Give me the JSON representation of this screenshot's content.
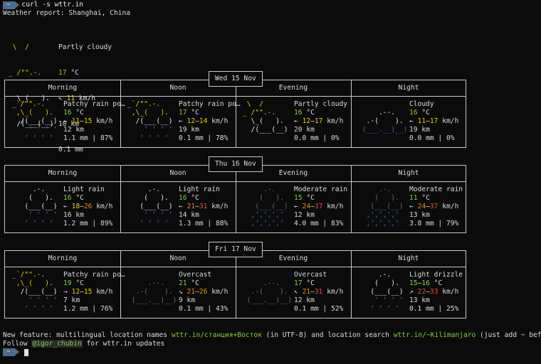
{
  "prompt": {
    "tilde": "~",
    "command": "curl -s wttr.in"
  },
  "report_title": "Weather report: Shanghai, China",
  "current": {
    "art": [
      " \\  /      ",
      "_ /\"\".-.   ",
      "  \\_(   ).  ",
      "  /(___(__) "
    ],
    "condition": "Partly cloudy",
    "temp": "17",
    "temp_unit": " °C",
    "wind_arrow": "↖ ",
    "wind": "11",
    "wind_unit": " km/h",
    "visibility": "10 km",
    "precip": "0.1 mm"
  },
  "periods": [
    "Morning",
    "Noon",
    "Evening",
    "Night"
  ],
  "days": [
    {
      "label": "Wed 15 Nov",
      "slots": [
        {
          "art": [
            "_`/\"\".-.   ",
            " ,\\_(   ).  ",
            "  /(___(__) ",
            "    ‘ ‘ ‘ ‘ ",
            "   ‘ ‘ ‘ ‘  "
          ],
          "condition": "Patchy rain po…",
          "temp": "16",
          "wind_arrow": "← ",
          "wind_a": "11",
          "wind_b": "15",
          "wind_color_a": "y",
          "wind_color_b": "y",
          "vis": "12 km",
          "precip": "1.1 mm | 87%",
          "artcolor": "mix"
        },
        {
          "art": [
            "_`/\"\".-.   ",
            " ,\\_(   ).  ",
            "  /(___(__) ",
            "    ‘ ‘ ‘ ‘ ",
            "   ‘ ‘ ‘ ‘  "
          ],
          "condition": "Patchy rain po…",
          "temp": "17",
          "wind_arrow": "← ",
          "wind_a": "12",
          "wind_b": "14",
          "wind_color_a": "y",
          "wind_color_b": "y",
          "vis": "19 km",
          "precip": "0.1 mm | 78%",
          "artcolor": "mix"
        },
        {
          "art": [
            " \\  /      ",
            "_ /\"\".-.   ",
            "  \\_(   ).  ",
            "  /(___(__) ",
            "            "
          ],
          "condition": "Partly cloudy",
          "temp": "16",
          "wind_arrow": "← ",
          "wind_a": "12",
          "wind_b": "17",
          "wind_color_a": "y",
          "wind_color_b": "y",
          "vis": "20 km",
          "precip": "0.0 mm | 0%",
          "artcolor": "sun"
        },
        {
          "art": [
            "            ",
            "     .--.   ",
            "  .-(    ).  ",
            " (___.__)__) ",
            "            "
          ],
          "condition": "Cloudy",
          "temp": "16",
          "wind_arrow": "← ",
          "wind_a": "11",
          "wind_b": "17",
          "wind_color_a": "y",
          "wind_color_b": "y",
          "vis": "19 km",
          "precip": "0.0 mm | 0%",
          "artcolor": "white"
        }
      ]
    },
    {
      "label": "Thu 16 Nov",
      "slots": [
        {
          "art": [
            "     .-.    ",
            "    (   ).  ",
            "   (___(__) ",
            "    ‘ ‘ ‘ ‘ ",
            "   ‘ ‘ ‘ ‘  "
          ],
          "condition": "Light rain",
          "temp": "16",
          "wind_arrow": "← ",
          "wind_a": "18",
          "wind_b": "26",
          "wind_color_a": "y",
          "wind_color_b": "o",
          "vis": "16 km",
          "precip": "1.2 mm | 89%",
          "artcolor": "white"
        },
        {
          "art": [
            "     .-.    ",
            "    (   ).  ",
            "   (___(__) ",
            "    ‘ ‘ ‘ ‘ ",
            "   ‘ ‘ ‘ ‘  "
          ],
          "condition": "Light rain",
          "temp": "16",
          "wind_arrow": "← ",
          "wind_a": "21",
          "wind_b": "31",
          "wind_color_a": "o",
          "wind_color_b": "r",
          "vis": "14 km",
          "precip": "1.3 mm | 88%",
          "artcolor": "white"
        },
        {
          "art": [
            "     .-.    ",
            "    (   ).  ",
            "   (___(__) ",
            "  ‚‘‚‘‚‘‚‘  ",
            "  ‚’‚’‚’‚’  "
          ],
          "condition": "Moderate rain",
          "temp": "15",
          "wind_arrow": "← ",
          "wind_a": "24",
          "wind_b": "37",
          "wind_color_a": "o",
          "wind_color_b": "r",
          "vis": "12 km",
          "precip": "4.0 mm | 83%",
          "artcolor": "grayblue"
        },
        {
          "art": [
            "     .-.    ",
            "    (   ).  ",
            "   (___(__) ",
            "  ‚‘‚‘‚‘‚‘  ",
            "  ‚’‚’‚’‚’  "
          ],
          "condition": "Moderate rain",
          "temp": "11",
          "wind_arrow": "← ",
          "wind_a": "24",
          "wind_b": "37",
          "wind_color_a": "o",
          "wind_color_b": "r",
          "vis": "13 km",
          "precip": "3.8 mm | 79%",
          "artcolor": "grayblue"
        }
      ]
    },
    {
      "label": "Fri 17 Nov",
      "slots": [
        {
          "art": [
            "_`/\"\".-.   ",
            " ,\\_(   ).  ",
            "  /(___(__) ",
            "    ‘ ‘ ‘ ‘ ",
            "   ‘ ‘ ‘ ‘  "
          ],
          "condition": "Patchy rain po…",
          "temp": "19",
          "wind_arrow": "→ ",
          "wind_a": "12",
          "wind_b": "15",
          "wind_color_a": "y",
          "wind_color_b": "y",
          "vis": "7 km",
          "precip": "1.2 mm | 76%",
          "artcolor": "mix"
        },
        {
          "art": [
            "            ",
            "     .--.   ",
            "  .-(    ).  ",
            " (___.__)__) ",
            "            "
          ],
          "condition": "Overcast",
          "temp": "21",
          "wind_arrow": "↘ ",
          "wind_a": "21",
          "wind_b": "26",
          "wind_color_a": "o",
          "wind_color_b": "o",
          "vis": "9 km",
          "precip": "0.1 mm | 43%",
          "artcolor": "gray"
        },
        {
          "art": [
            "            ",
            "     .--.   ",
            "  .-(    ).  ",
            " (___.__)__) ",
            "            "
          ],
          "condition": "Overcast",
          "temp": "17",
          "wind_arrow": "↖ ",
          "wind_a": "21",
          "wind_b": "31",
          "wind_color_a": "o",
          "wind_color_b": "r",
          "vis": "12 km",
          "precip": "0.1 mm | 52%",
          "artcolor": "gray"
        },
        {
          "art": [
            "     .-.    ",
            "    (   ).  ",
            "   (___(__) ",
            "    ‘ ‘ ‘ ‘ ",
            "   ‘ ‘ ‘ ‘  "
          ],
          "condition": "Light drizzle",
          "temp": "15",
          "temp_b": "16",
          "wind_arrow": "↗ ",
          "wind_a": "22",
          "wind_b": "33",
          "wind_color_a": "r",
          "wind_color_b": "r",
          "vis": "13 km",
          "precip": "0.1 mm | 25%",
          "artcolor": "white"
        }
      ]
    }
  ],
  "footer": {
    "line1_a": "New feature: multilingual location names ",
    "line1_link1": "wttr.in/станция+Восток",
    "line1_b": " (in UTF-8) and location search ",
    "line1_link2": "wttr.in/~Kilimanjaro",
    "line1_c": " (just add ~ before)",
    "line2_a": "Follow ",
    "line2_handle": "@igor_chubin",
    "line2_b": " for wttr.in updates"
  },
  "prompt2": {
    "tilde": "~"
  }
}
